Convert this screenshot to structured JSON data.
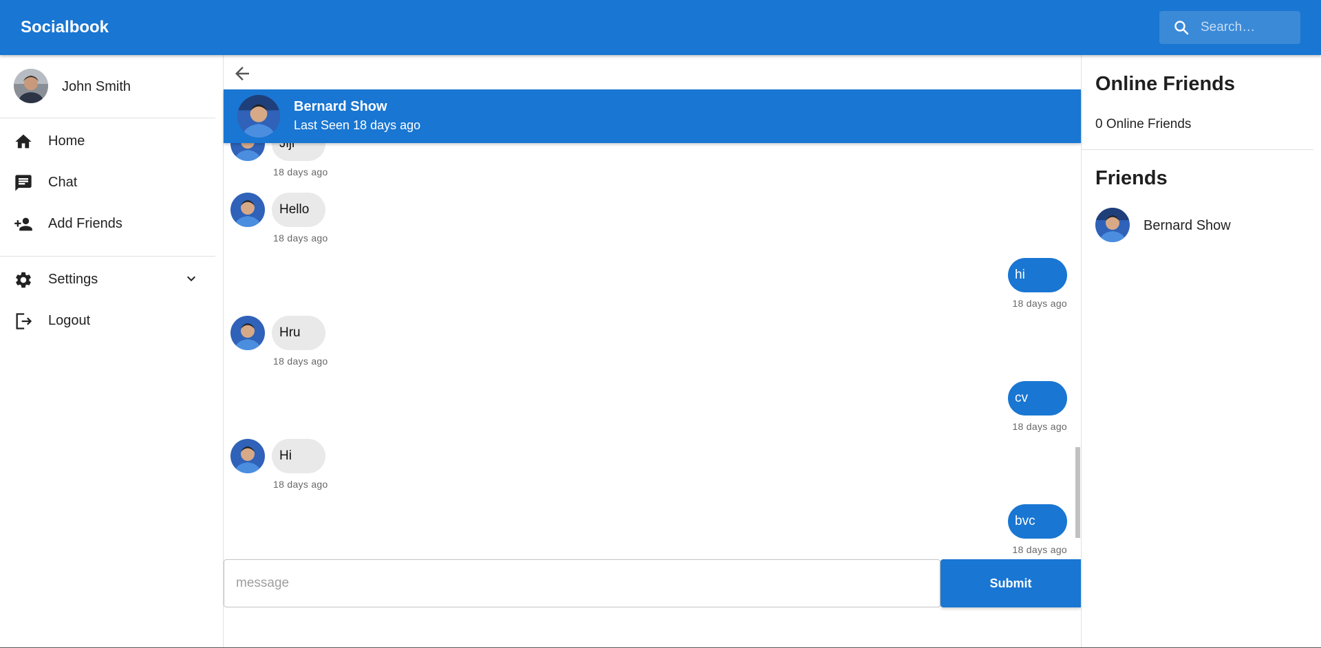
{
  "app": {
    "brand": "Socialbook"
  },
  "search": {
    "placeholder": "Search…"
  },
  "user": {
    "name": "John Smith"
  },
  "nav": {
    "items": [
      {
        "label": "Home",
        "icon": "home-icon"
      },
      {
        "label": "Chat",
        "icon": "chat-icon"
      },
      {
        "label": "Add Friends",
        "icon": "add-friend-icon"
      }
    ],
    "settings": {
      "label": "Settings",
      "icon": "gear-icon"
    },
    "logout": {
      "label": "Logout",
      "icon": "logout-icon"
    }
  },
  "chat": {
    "contact": {
      "name": "Bernard Show",
      "last_seen": "Last Seen 18 days ago"
    },
    "messages": [
      {
        "dir": "in",
        "text": "Jiji",
        "time": "18 days ago"
      },
      {
        "dir": "in",
        "text": "Hello",
        "time": "18 days ago"
      },
      {
        "dir": "out",
        "text": "hi",
        "time": "18 days ago"
      },
      {
        "dir": "in",
        "text": "Hru",
        "time": "18 days ago"
      },
      {
        "dir": "out",
        "text": "cv",
        "time": "18 days ago"
      },
      {
        "dir": "in",
        "text": "Hi",
        "time": "18 days ago"
      },
      {
        "dir": "out",
        "text": "bvc",
        "time": "18 days ago"
      }
    ],
    "composer": {
      "placeholder": "message",
      "submit_label": "Submit"
    }
  },
  "right": {
    "online_title": "Online Friends",
    "online_count": "0 Online Friends",
    "friends_title": "Friends",
    "friends": [
      {
        "name": "Bernard Show"
      }
    ]
  },
  "colors": {
    "primary": "#1976d2",
    "bubble_in": "#e9e9e9"
  }
}
